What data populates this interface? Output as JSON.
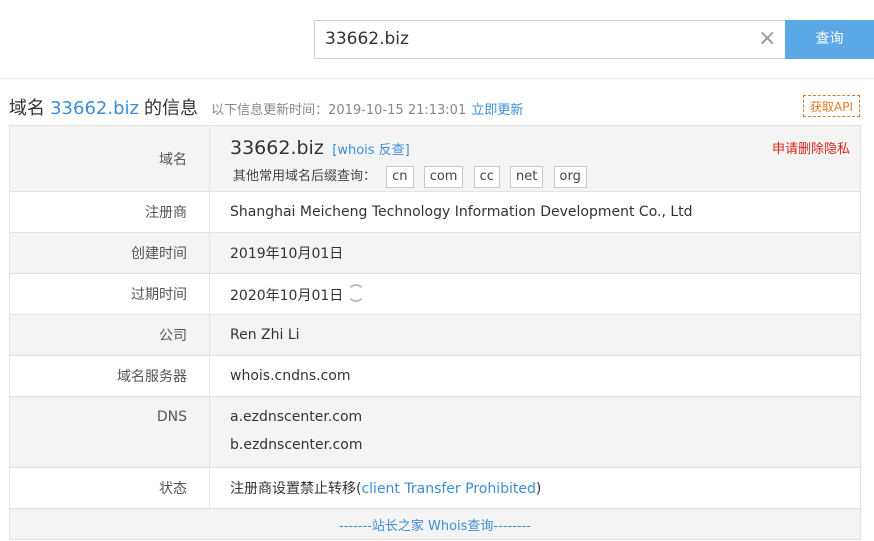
{
  "search": {
    "value": "33662.biz",
    "button_label": "查询"
  },
  "heading": {
    "prefix": "域名",
    "domain": "33662.biz",
    "suffix": "的信息",
    "update_text": "以下信息更新时间：2019-10-15 21:13:01",
    "update_now": "立即更新",
    "api_button": "获取API"
  },
  "rows": {
    "domain": {
      "label": "域名",
      "value": "33662.biz",
      "whois_link": "[whois 反查]",
      "privacy_link": "申请删除隐私",
      "suffix_prompt": "其他常用域名后缀查询：",
      "suffixes": [
        "cn",
        "com",
        "cc",
        "net",
        "org"
      ]
    },
    "registrar": {
      "label": "注册商",
      "value": "Shanghai Meicheng Technology Information Development Co., Ltd"
    },
    "created": {
      "label": "创建时间",
      "value": "2019年10月01日"
    },
    "expires": {
      "label": "过期时间",
      "value": "2020年10月01日"
    },
    "company": {
      "label": "公司",
      "value": "Ren Zhi Li"
    },
    "whois_server": {
      "label": "域名服务器",
      "value": "whois.cndns.com"
    },
    "dns": {
      "label": "DNS",
      "values": [
        "a.ezdnscenter.com",
        "b.ezdnscenter.com"
      ]
    },
    "status": {
      "label": "状态",
      "value_prefix": "注册商设置禁止转移(",
      "value_link": "client Transfer Prohibited",
      "value_suffix": ")"
    }
  },
  "footer": {
    "text": "-------站长之家 Whois查询--------"
  }
}
